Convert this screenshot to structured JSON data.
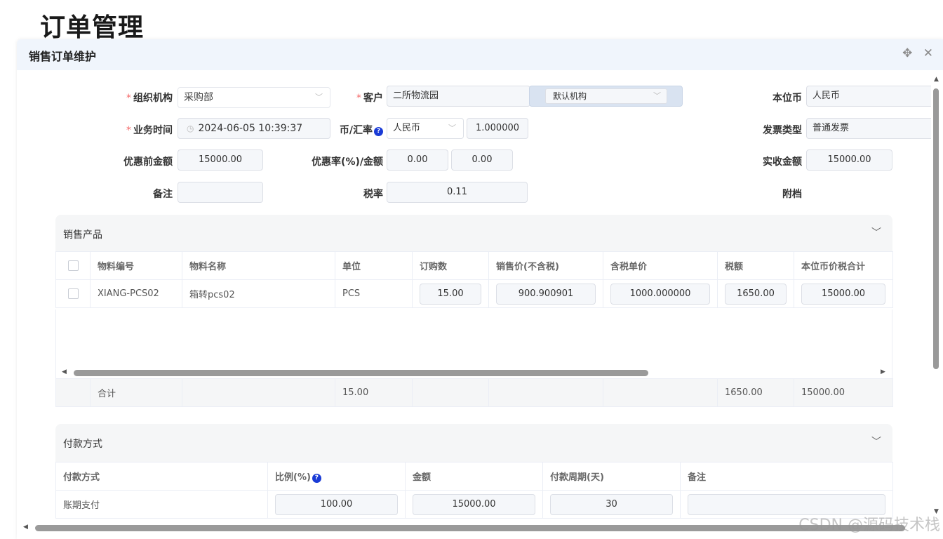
{
  "page_title": "订单管理",
  "dialog": {
    "title": "销售订单维护",
    "icons": [
      "move-icon",
      "close-icon"
    ]
  },
  "form": {
    "org_label": "组织机构",
    "org_value": "采购部",
    "customer_label": "客户",
    "customer_value": "二所物流园",
    "customer_org_value": "默认机构",
    "base_currency_label": "本位币",
    "base_currency_value": "人民币",
    "biz_time_label": "业务时间",
    "biz_time_value": "2024-06-05 10:39:37",
    "rate_label": "币/汇率",
    "currency_value": "人民币",
    "exchange_rate_value": "1.000000",
    "invoice_type_label": "发票类型",
    "invoice_type_value": "普通发票",
    "pre_discount_label": "优惠前金额",
    "pre_discount_value": "15000.00",
    "discount_label": "优惠率(%)/金额",
    "discount_rate_value": "0.00",
    "discount_amount_value": "0.00",
    "received_label": "实收金额",
    "received_value": "15000.00",
    "remark_label": "备注",
    "remark_value": "",
    "tax_rate_label": "税率",
    "tax_rate_value": "0.11",
    "attachment_label": "附档"
  },
  "products": {
    "title": "销售产品",
    "columns": [
      "物料编号",
      "物料名称",
      "单位",
      "订购数",
      "销售价(不含税)",
      "含税单价",
      "税额",
      "本位币价税合计"
    ],
    "rows": [
      {
        "code": "XIANG-PCS02",
        "name": "箱转pcs02",
        "unit": "PCS",
        "qty": "15.00",
        "price": "900.900901",
        "tax_price": "1000.000000",
        "tax": "1650.00",
        "total": "15000.00"
      }
    ],
    "footer": {
      "label": "合计",
      "qty": "15.00",
      "tax": "1650.00",
      "total": "15000.00"
    }
  },
  "payment": {
    "title": "付款方式",
    "columns": [
      "付款方式",
      "比例(%)",
      "金额",
      "付款周期(天)",
      "备注"
    ],
    "rows": [
      {
        "method": "账期支付",
        "ratio": "100.00",
        "amount": "15000.00",
        "period": "30",
        "remark": ""
      }
    ]
  },
  "watermark": "CSDN @源码技术栈",
  "colors": {
    "required": "#f56c6c",
    "help": "#1a3bd6",
    "header_bg": "#f0f5fc"
  }
}
